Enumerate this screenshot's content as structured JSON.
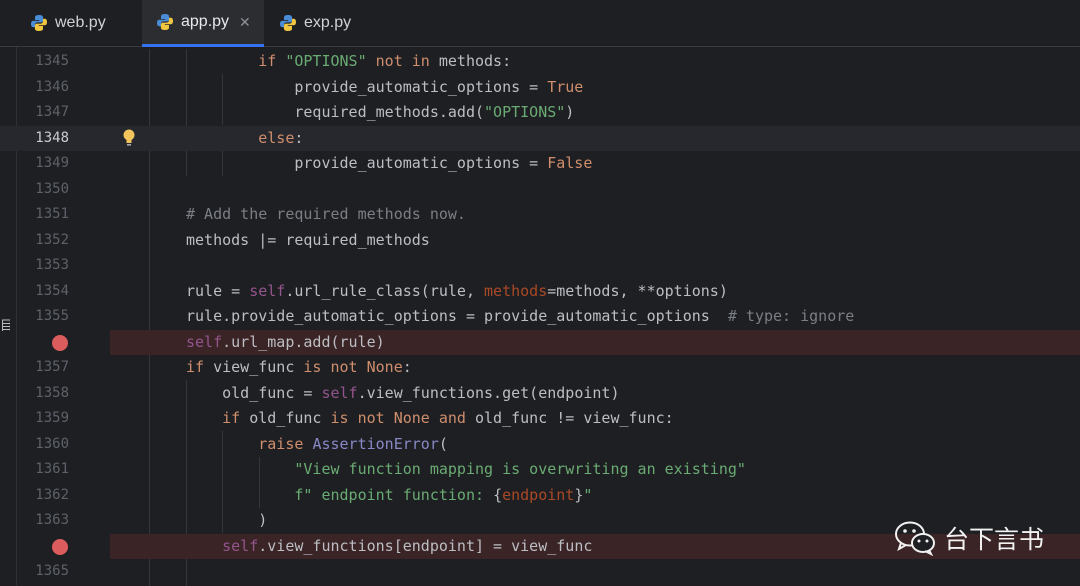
{
  "tabs": [
    {
      "label": "web.py",
      "active": false
    },
    {
      "label": "app.py",
      "active": true
    },
    {
      "label": "exp.py",
      "active": false
    }
  ],
  "side_char": "目",
  "current_line": 1348,
  "breakpoint_lines": [
    1356,
    1364
  ],
  "lines": [
    {
      "num": "1345",
      "tokens": [
        [
          "    ",
          ""
        ],
        [
          "if ",
          "kw"
        ],
        [
          "\"OPTIONS\"",
          "str"
        ],
        [
          " ",
          ""
        ],
        [
          "not in",
          "kw"
        ],
        [
          " methods:",
          ""
        ]
      ]
    },
    {
      "num": "1346",
      "tokens": [
        [
          "        provide_automatic_options = ",
          ""
        ],
        [
          "True",
          "kw"
        ]
      ]
    },
    {
      "num": "1347",
      "tokens": [
        [
          "        required_methods.add(",
          ""
        ],
        [
          "\"OPTIONS\"",
          "str"
        ],
        [
          ")",
          ""
        ]
      ]
    },
    {
      "num": "1348",
      "tokens": [
        [
          "    ",
          ""
        ],
        [
          "else",
          "kw"
        ],
        [
          ":",
          ""
        ]
      ]
    },
    {
      "num": "1349",
      "tokens": [
        [
          "        provide_automatic_options = ",
          ""
        ],
        [
          "False",
          "kw"
        ]
      ]
    },
    {
      "num": "1350",
      "tokens": []
    },
    {
      "num": "1351",
      "tokens": [
        [
          "# Add the required methods now.",
          "cm"
        ]
      ]
    },
    {
      "num": "1352",
      "tokens": [
        [
          "methods |= required_methods",
          ""
        ]
      ]
    },
    {
      "num": "1353",
      "tokens": []
    },
    {
      "num": "1354",
      "tokens": [
        [
          "rule = ",
          ""
        ],
        [
          "self",
          "self"
        ],
        [
          ".url_rule_class(rule, ",
          ""
        ],
        [
          "methods",
          "param"
        ],
        [
          "=methods, **options)",
          ""
        ]
      ]
    },
    {
      "num": "1355",
      "tokens": [
        [
          "rule.provide_automatic_options = provide_automatic_options  ",
          ""
        ],
        [
          "# type: ignore",
          "cm"
        ]
      ]
    },
    {
      "num": "",
      "tokens": [
        [
          "self",
          "self"
        ],
        [
          ".url_map.add(rule)",
          ""
        ]
      ]
    },
    {
      "num": "1357",
      "tokens": [
        [
          "if ",
          "kw"
        ],
        [
          "view_func ",
          ""
        ],
        [
          "is not None",
          "kw"
        ],
        [
          ":",
          ""
        ]
      ]
    },
    {
      "num": "1358",
      "tokens": [
        [
          "    old_func = ",
          ""
        ],
        [
          "self",
          "self"
        ],
        [
          ".view_functions.get(endpoint)",
          ""
        ]
      ]
    },
    {
      "num": "1359",
      "tokens": [
        [
          "    ",
          ""
        ],
        [
          "if ",
          "kw"
        ],
        [
          "old_func ",
          ""
        ],
        [
          "is not None and ",
          "kw"
        ],
        [
          "old_func != view_func:",
          ""
        ]
      ]
    },
    {
      "num": "1360",
      "tokens": [
        [
          "        ",
          ""
        ],
        [
          "raise ",
          "kw"
        ],
        [
          "AssertionError",
          "cls"
        ],
        [
          "(",
          ""
        ]
      ]
    },
    {
      "num": "1361",
      "tokens": [
        [
          "            ",
          ""
        ],
        [
          "\"View function mapping is overwriting an existing\"",
          "str"
        ]
      ]
    },
    {
      "num": "1362",
      "tokens": [
        [
          "            ",
          ""
        ],
        [
          "f\" endpoint function: ",
          "str"
        ],
        [
          "{",
          ""
        ],
        [
          "endpoint",
          "param"
        ],
        [
          "}",
          ""
        ],
        [
          "\"",
          "str"
        ]
      ]
    },
    {
      "num": "1363",
      "tokens": [
        [
          "        )",
          ""
        ]
      ]
    },
    {
      "num": "",
      "tokens": [
        [
          "    ",
          ""
        ],
        [
          "self",
          "self"
        ],
        [
          ".view_functions[endpoint] = view_func",
          ""
        ]
      ]
    },
    {
      "num": "1365",
      "tokens": []
    }
  ],
  "watermark": {
    "text": "台下言书"
  },
  "colors": {
    "background": "#1e1f22",
    "keyword": "#cf8e6d",
    "string": "#6aab73",
    "comment": "#7a7e85",
    "breakpoint": "#db5c5c"
  }
}
